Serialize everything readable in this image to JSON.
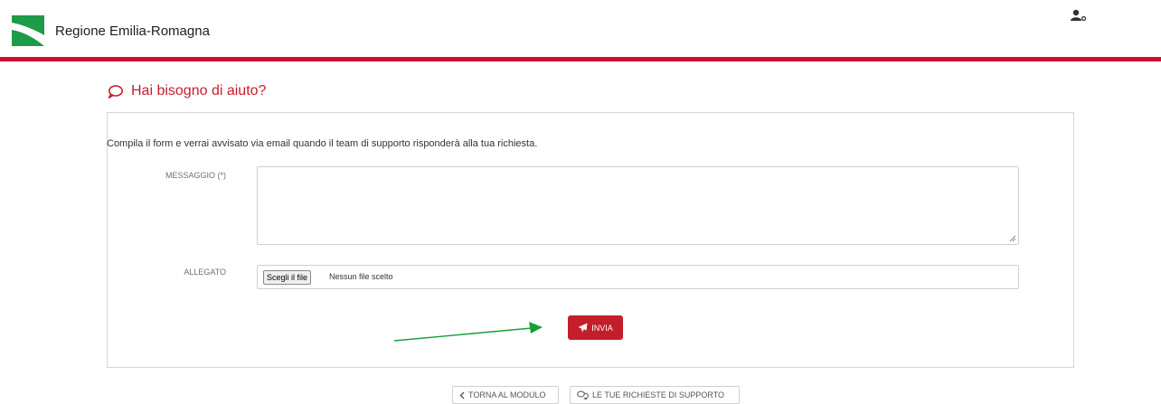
{
  "header": {
    "brand_name": "Regione Emilia-Romagna",
    "logo_icon": "regione-logo-icon",
    "user_icon": "user-key-icon",
    "accent_color": "#c8102e"
  },
  "help": {
    "title": "Hai bisogno di aiuto?",
    "title_icon": "speech-bubble-icon",
    "intro": "Compila il form e verrai avvisato via email quando il team di supporto risponderà alla tua richiesta."
  },
  "form": {
    "message_label": "MESSAGGIO (*)",
    "message_value": "",
    "attachment_label": "ALLEGATO",
    "file_button_label": "Scegli il file",
    "file_status": "Nessun file scelto",
    "submit_label": "INVIA",
    "submit_icon": "paper-plane-icon",
    "submit_color": "#c41e2b"
  },
  "annotation": {
    "arrow_color": "#1a9e3a"
  },
  "footer_nav": {
    "back_label": "TORNA AL MODULO",
    "back_icon": "chevron-left-icon",
    "requests_label": "LE TUE RICHIESTE DI SUPPORTO",
    "requests_icon": "chat-bubbles-icon"
  }
}
